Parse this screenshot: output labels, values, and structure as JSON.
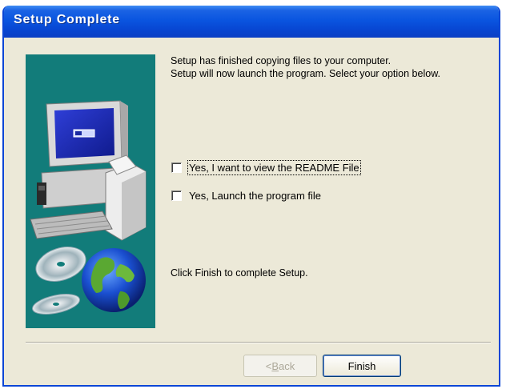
{
  "window": {
    "title": "Setup Complete"
  },
  "content": {
    "message_line1": "Setup has finished copying files to your computer.",
    "message_line2": "Setup will now launch the program. Select your option below.",
    "checkboxes": [
      {
        "label": "Yes, I want to view the README File",
        "checked": false,
        "focused": true
      },
      {
        "label": "Yes, Launch the program file",
        "checked": false,
        "focused": false
      }
    ],
    "finish_message": "Click Finish to complete Setup."
  },
  "buttons": {
    "back_prefix": "< ",
    "back_mnemonic": "B",
    "back_rest": "ack",
    "back_enabled": false,
    "finish_label": "Finish"
  },
  "icons": {
    "side_image": "computer-with-cds-and-globe-illustration"
  },
  "colors": {
    "titlebar": "#0a55e0",
    "dialog_bg": "#ece9d8",
    "illustration_bg": "#127c7a"
  }
}
